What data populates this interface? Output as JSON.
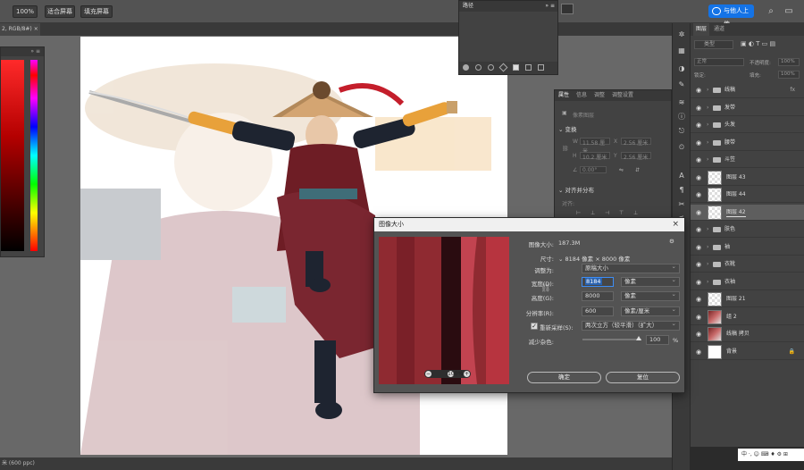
{
  "options_bar": {
    "zoom": "100%",
    "fit_screen": "适合屏幕",
    "fill_screen": "填充屏幕",
    "share_button": "与他人上传"
  },
  "doc_tab": {
    "title": "2, RGB/8#)"
  },
  "status": {
    "text": "米 (600 ppc)"
  },
  "color_panel": {
    "menu": "» ≡"
  },
  "paths_panel": {
    "title": "路径",
    "menu": "» ≡"
  },
  "properties_panel": {
    "tabs": [
      "属性",
      "信息",
      "调整",
      "调整设置"
    ],
    "layer_type": "像素图层",
    "transform_title": "变换",
    "align_title": "对齐并分布",
    "align_label": "对齐:",
    "w_label": "W",
    "w_value": "11.58 厘米",
    "h_label": "H",
    "h_value": "10.2 厘米",
    "x_label": "X",
    "x_value": "2.56 厘米",
    "y_label": "Y",
    "y_value": "2.56 厘米",
    "angle_value": "0.00°"
  },
  "layers_panel": {
    "tabs": [
      "图层",
      "通道"
    ],
    "filter_placeholder": "类型",
    "blend_mode": "正常",
    "opacity_label": "不透明度:",
    "opacity_value": "100%",
    "lock_label": "锁定:",
    "fill_label": "填充:",
    "fill_value": "100%",
    "fx": "fx",
    "layers": [
      {
        "name": "线稿",
        "type": "folder",
        "selected": false
      },
      {
        "name": "发带",
        "type": "folder",
        "selected": false
      },
      {
        "name": "头发",
        "type": "folder",
        "selected": false
      },
      {
        "name": "腰带",
        "type": "folder",
        "selected": false
      },
      {
        "name": "斗笠",
        "type": "folder",
        "selected": false
      },
      {
        "name": "图层 43",
        "type": "layer",
        "selected": false
      },
      {
        "name": "图层 44",
        "type": "layer",
        "selected": false
      },
      {
        "name": "图层 42",
        "type": "layer",
        "selected": true
      },
      {
        "name": "肤色",
        "type": "folder",
        "selected": false
      },
      {
        "name": "袖",
        "type": "folder",
        "selected": false
      },
      {
        "name": "衣靴",
        "type": "folder",
        "selected": false
      },
      {
        "name": "衣袖",
        "type": "folder",
        "selected": false
      },
      {
        "name": "图层 21",
        "type": "layer",
        "selected": false
      },
      {
        "name": "组 2",
        "type": "image",
        "selected": false
      },
      {
        "name": "线稿 拷贝",
        "type": "image",
        "selected": false
      },
      {
        "name": "背景",
        "type": "bg",
        "selected": false
      }
    ]
  },
  "dialog": {
    "title": "图像大小",
    "zoom": "100%",
    "image_size_label": "图像大小:",
    "image_size_value": "187.3M",
    "dimensions_label": "尺寸:",
    "dim_w": "8184",
    "dim_unit": "像素",
    "dim_x": "×",
    "dim_h": "8000",
    "fit_label": "调整为:",
    "fit_value": "原稿大小",
    "width_label": "宽度(D):",
    "width_value": "8184",
    "width_unit": "像素",
    "height_label": "高度(G):",
    "height_value": "8000",
    "height_unit": "像素",
    "resolution_label": "分辨率(R):",
    "resolution_value": "600",
    "resolution_unit": "像素/厘米",
    "resample_label": "重新采样(S):",
    "resample_value": "两次立方（较平滑）（扩大）",
    "noise_label": "减少杂色:",
    "noise_value": "100",
    "noise_unit": "%",
    "ok": "确定",
    "cancel": "复位"
  },
  "taskbar": {
    "ime": "中 ·, ☺ ⌨ ♦ ⚙ ⊞"
  },
  "colors": {
    "accent": "#1473e6",
    "robe": "#7a2630",
    "sleeve": "#2a3445",
    "hat": "#c9a06a",
    "arm_guard": "#e8a13a"
  }
}
